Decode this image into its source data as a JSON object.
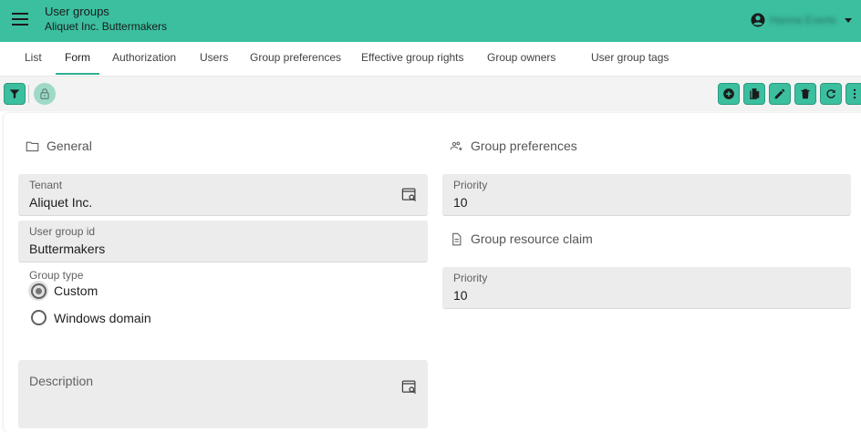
{
  "header": {
    "title": "User groups",
    "subtitle": "Aliquet Inc.  Buttermakers",
    "user_name": "Hanna Everts",
    "accent": "#3bbf9f"
  },
  "tabs": [
    {
      "label": "List"
    },
    {
      "label": "Form",
      "active": true
    },
    {
      "label": "Authorization"
    },
    {
      "label": "Users"
    },
    {
      "label": "Group preferences"
    },
    {
      "label": "Effective group rights"
    },
    {
      "label": "Group owners"
    },
    {
      "label": "User group tags"
    }
  ],
  "toolbar": {
    "left_icons": [
      "filter-icon",
      "lock-icon"
    ],
    "right_icons": [
      "add-icon",
      "copy-icon",
      "edit-icon",
      "delete-icon",
      "refresh-icon",
      "more-vert-icon"
    ]
  },
  "general": {
    "title": "General",
    "tenant": {
      "label": "Tenant",
      "value": "Aliquet Inc."
    },
    "user_group_id": {
      "label": "User group id",
      "value": "Buttermakers"
    },
    "group_type": {
      "label": "Group type",
      "options": [
        "Custom",
        "Windows domain"
      ],
      "selected": "Custom"
    },
    "description": {
      "label": "Description",
      "value": ""
    }
  },
  "group_preferences": {
    "title": "Group preferences",
    "priority": {
      "label": "Priority",
      "value": "10"
    }
  },
  "group_resource_claim": {
    "title": "Group resource claim",
    "priority": {
      "label": "Priority",
      "value": "10"
    }
  }
}
